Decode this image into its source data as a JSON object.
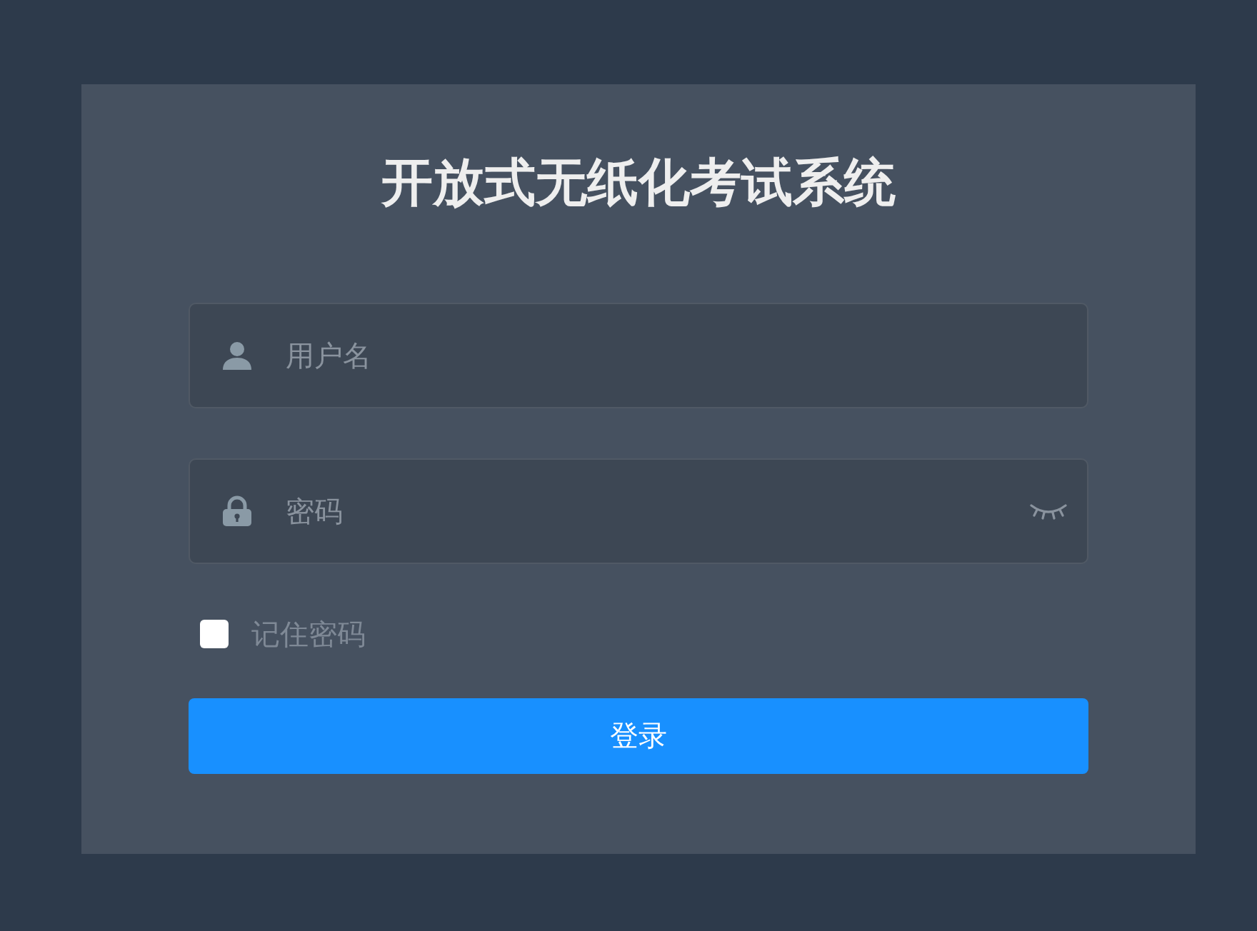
{
  "title": "开放式无纸化考试系统",
  "fields": [
    {
      "kind": "username",
      "placeholder": "用户名"
    },
    {
      "kind": "password",
      "placeholder": "密码"
    }
  ],
  "remember": {
    "label": "记住密码",
    "checked": false
  },
  "login_button": "登录"
}
